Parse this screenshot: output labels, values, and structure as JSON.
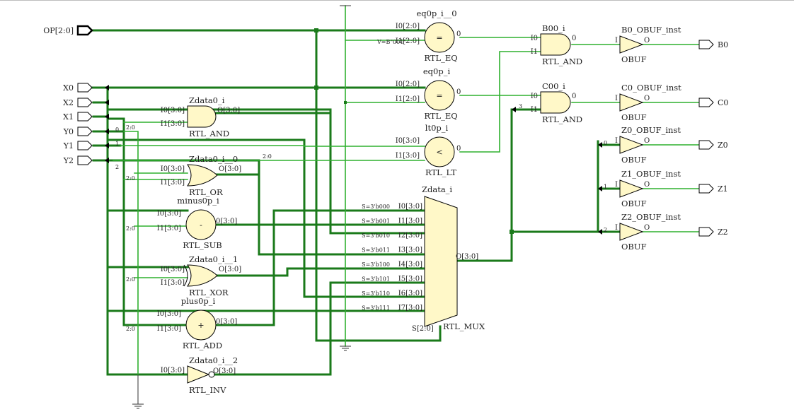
{
  "inputs": [
    {
      "id": "OP",
      "label": "OP[2:0]"
    },
    {
      "id": "X0",
      "label": "X0"
    },
    {
      "id": "X2",
      "label": "X2"
    },
    {
      "id": "X1",
      "label": "X1"
    },
    {
      "id": "Y0",
      "label": "Y0"
    },
    {
      "id": "Y1",
      "label": "Y1"
    },
    {
      "id": "Y2",
      "label": "Y2"
    }
  ],
  "outputs": [
    {
      "id": "B0",
      "label": "B0"
    },
    {
      "id": "C0",
      "label": "C0"
    },
    {
      "id": "Z0",
      "label": "Z0"
    },
    {
      "id": "Z1",
      "label": "Z1"
    },
    {
      "id": "Z2",
      "label": "Z2"
    }
  ],
  "cells": {
    "eq1": {
      "name": "eq0p_i__0",
      "type": "RTL_EQ",
      "symbol": "=",
      "in": [
        "I0[2:0]",
        "I1[2:0]"
      ],
      "out": "0",
      "const": "V=B\"001\""
    },
    "eq2": {
      "name": "eq0p_i",
      "type": "RTL_EQ",
      "symbol": "=",
      "in": [
        "I0[2:0]",
        "I1[2:0]"
      ],
      "out": "0"
    },
    "lt": {
      "name": "lt0p_i",
      "type": "RTL_LT",
      "symbol": "<",
      "in": [
        "I0[3:0]",
        "I1[3:0]"
      ],
      "out": "0"
    },
    "and_b": {
      "name": "B00_i",
      "type": "RTL_AND",
      "in": [
        "I0",
        "I1"
      ],
      "out": "0"
    },
    "and_c": {
      "name": "C00_i",
      "type": "RTL_AND",
      "in": [
        "I0",
        "I1"
      ],
      "out": "0"
    },
    "and_z": {
      "name": "Zdata0_i",
      "type": "RTL_AND",
      "in": [
        "I0[3:0]",
        "I1[3:0]"
      ],
      "out": "O[3:0]"
    },
    "or_z": {
      "name": "Zdata0_i__0",
      "type": "RTL_OR",
      "in": [
        "I0[3:0]",
        "I1[3:0]"
      ],
      "out": "O[3:0]"
    },
    "sub": {
      "name": "minus0p_i",
      "type": "RTL_SUB",
      "symbol": "-",
      "in": [
        "I0[3:0]",
        "I1[3:0]"
      ],
      "out": "0[3:0]"
    },
    "xor_z": {
      "name": "Zdata0_i__1",
      "type": "RTL_XOR",
      "in": [
        "I0[3:0]",
        "I1[3:0]"
      ],
      "out": "O[3:0]"
    },
    "add": {
      "name": "plus0p_i",
      "type": "RTL_ADD",
      "symbol": "+",
      "in": [
        "I0[3:0]",
        "I1[3:0]"
      ],
      "out": "0[3:0]"
    },
    "inv": {
      "name": "Zdata0_i__2",
      "type": "RTL_INV",
      "in": [
        "I0[3:0]"
      ],
      "out": "O[3:0]"
    },
    "mux": {
      "name": "Zdata_i",
      "type": "RTL_MUX",
      "out": "O[3:0]",
      "sel": "S[2:0]",
      "inputs": [
        {
          "port": "I0[3:0]",
          "s": "S=3'b000"
        },
        {
          "port": "I1[3:0]",
          "s": "S=3'b001"
        },
        {
          "port": "I2[3:0]",
          "s": "S=3'b010"
        },
        {
          "port": "I3[3:0]",
          "s": "S=3'b011"
        },
        {
          "port": "I4[3:0]",
          "s": "S=3'b100"
        },
        {
          "port": "I5[3:0]",
          "s": "S=3'b101"
        },
        {
          "port": "I6[3:0]",
          "s": "S=3'b110"
        },
        {
          "port": "I7[3:0]",
          "s": "S=3'b111"
        }
      ]
    },
    "obuf_b": {
      "name": "B0_OBUF_inst",
      "type": "OBUF",
      "in": "I",
      "out": "O"
    },
    "obuf_c": {
      "name": "C0_OBUF_inst",
      "type": "OBUF",
      "in": "I",
      "out": "O"
    },
    "obuf_z0": {
      "name": "Z0_OBUF_inst",
      "type": "OBUF",
      "in": "I",
      "out": "O"
    },
    "obuf_z1": {
      "name": "Z1_OBUF_inst",
      "type": "OBUF",
      "in": "I",
      "out": "O"
    },
    "obuf_z2": {
      "name": "Z2_OBUF_inst",
      "type": "OBUF",
      "in": "I",
      "out": "O"
    }
  },
  "bus_labels": {
    "slice": "2:0",
    "bit0": "0",
    "bit1": "1",
    "bit2": "2",
    "c_bit": "3"
  },
  "colors": {
    "wire": "#1a7a1a",
    "wire_light": "#2fb02f",
    "cell_fill": "#fff8c8",
    "stroke": "#000000"
  }
}
